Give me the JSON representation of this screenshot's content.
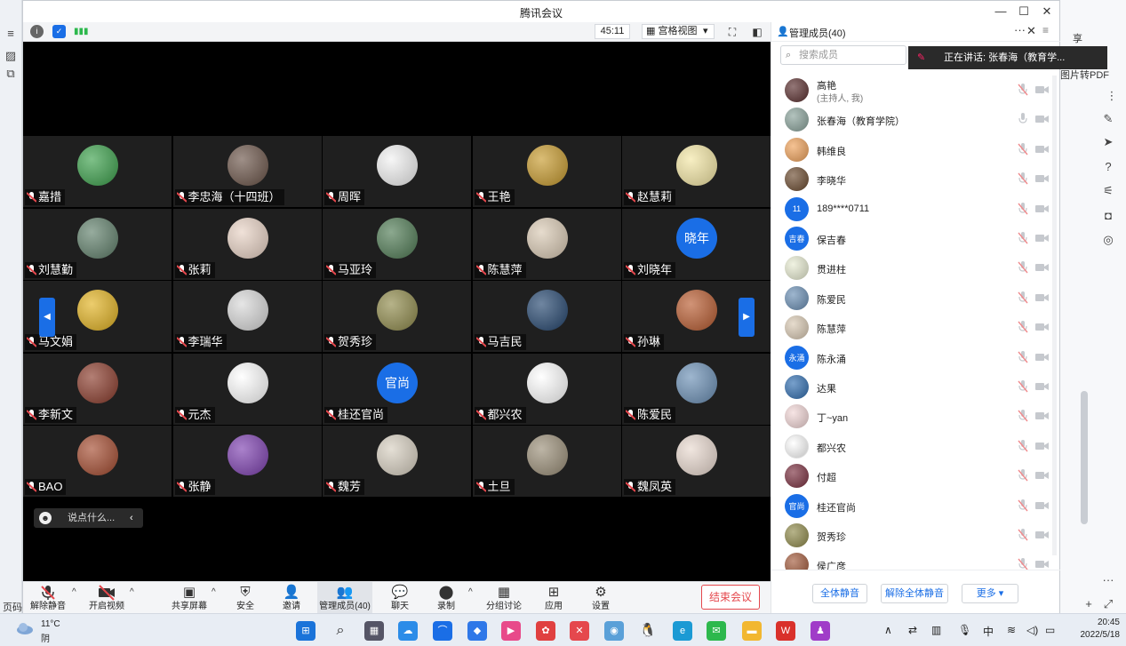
{
  "window": {
    "title": "腾讯会议",
    "controls": [
      "—",
      "☐",
      "✕"
    ]
  },
  "meeting_bar": {
    "timer": "45:11",
    "view_mode": "宫格视图",
    "view_caret": "▾"
  },
  "participants": [
    {
      "name": "嘉措",
      "avatar": {
        "type": "img",
        "bg": "#3aa04a"
      }
    },
    {
      "name": "李忠海（十四班）",
      "avatar": {
        "type": "img",
        "bg": "#6b5448"
      }
    },
    {
      "name": "周晖",
      "avatar": {
        "type": "img",
        "bg": "#f2f2f2"
      }
    },
    {
      "name": "王艳",
      "avatar": {
        "type": "img",
        "bg": "#c79a2c"
      }
    },
    {
      "name": "赵慧莉",
      "avatar": {
        "type": "img",
        "bg": "#f4e7a4"
      }
    },
    {
      "name": "刘慧勤",
      "avatar": {
        "type": "img",
        "bg": "#5f7f6a"
      }
    },
    {
      "name": "张莉",
      "avatar": {
        "type": "img",
        "bg": "#e8d2c4"
      }
    },
    {
      "name": "马亚玲",
      "avatar": {
        "type": "img",
        "bg": "#4e7a53"
      }
    },
    {
      "name": "陈慧萍",
      "avatar": {
        "type": "img",
        "bg": "#d9c9b3"
      }
    },
    {
      "name": "刘晓年",
      "avatar": {
        "type": "text",
        "text": "晓年",
        "bg": "#1a6ee6"
      }
    },
    {
      "name": "马文娟",
      "avatar": {
        "type": "img",
        "bg": "#e2b21f"
      }
    },
    {
      "name": "李瑞华",
      "avatar": {
        "type": "img",
        "bg": "#d8d8d8"
      }
    },
    {
      "name": "贺秀珍",
      "avatar": {
        "type": "img",
        "bg": "#8f8a4a"
      }
    },
    {
      "name": "马吉民",
      "avatar": {
        "type": "img",
        "bg": "#23456e"
      }
    },
    {
      "name": "孙琳",
      "avatar": {
        "type": "img",
        "bg": "#b85a2e"
      }
    },
    {
      "name": "李新文",
      "avatar": {
        "type": "img",
        "bg": "#8a3a2a"
      }
    },
    {
      "name": "元杰",
      "avatar": {
        "type": "img",
        "bg": "#ffffff"
      }
    },
    {
      "name": "桂还官尚",
      "avatar": {
        "type": "text",
        "text": "官尚",
        "bg": "#1a6ee6"
      }
    },
    {
      "name": "都兴农",
      "avatar": {
        "type": "img",
        "bg": "#ffffff"
      }
    },
    {
      "name": "陈爱民",
      "avatar": {
        "type": "img",
        "bg": "#6a8fb5"
      }
    },
    {
      "name": "BAO",
      "avatar": {
        "type": "img",
        "bg": "#a44a2e"
      }
    },
    {
      "name": "张静",
      "avatar": {
        "type": "img",
        "bg": "#7d3fb0"
      }
    },
    {
      "name": "魏芳",
      "avatar": {
        "type": "img",
        "bg": "#d7cfc0"
      }
    },
    {
      "name": "土旦",
      "avatar": {
        "type": "img",
        "bg": "#9a8e77"
      }
    },
    {
      "name": "魏凤英",
      "avatar": {
        "type": "img",
        "bg": "#e9d9cf"
      }
    }
  ],
  "pager": {
    "prev": "◀",
    "next": "▶"
  },
  "chat": {
    "placeholder": "说点什么...",
    "collapse": "‹",
    "emoji": "☻"
  },
  "toolbar": {
    "unmute": "解除静音",
    "start_video": "开启视频",
    "share_screen": "共享屏幕",
    "security": "安全",
    "invite": "邀请",
    "manage_members": "管理成员(40)",
    "chat": "聊天",
    "record": "录制",
    "breakout": "分组讨论",
    "apps": "应用",
    "settings": "设置",
    "end_meeting": "结束会议",
    "caret": "^"
  },
  "panel": {
    "title": "管理成员(40)",
    "more": "···",
    "close": "✕",
    "menu": "≡",
    "search_placeholder": "搜索成员",
    "speaking": "正在讲话: 张春海（教育学...",
    "mute_all": "全体静音",
    "unmute_all": "解除全体静音",
    "more_btn": "更多 ▾"
  },
  "members": [
    {
      "name": "高艳",
      "sub": "(主持人, 我)",
      "avatar": {
        "type": "img",
        "bg": "#5a2e2e"
      },
      "mic_muted": true
    },
    {
      "name": "张春海（教育学院）",
      "sub": "",
      "avatar": {
        "type": "img",
        "bg": "#8aa39b"
      },
      "mic_muted": false
    },
    {
      "name": "韩维良",
      "sub": "",
      "avatar": {
        "type": "img",
        "bg": "#f0a25a"
      },
      "mic_muted": true
    },
    {
      "name": "李晓华",
      "sub": "",
      "avatar": {
        "type": "img",
        "bg": "#6b4a2e"
      },
      "mic_muted": true
    },
    {
      "name": "189****0711",
      "sub": "",
      "avatar": {
        "type": "text",
        "text": "11",
        "bg": "#1a6ee6"
      },
      "mic_muted": true
    },
    {
      "name": "保吉春",
      "sub": "",
      "avatar": {
        "type": "text",
        "text": "吉春",
        "bg": "#1a6ee6"
      },
      "mic_muted": true
    },
    {
      "name": "贯进柱",
      "sub": "",
      "avatar": {
        "type": "img",
        "bg": "#e8ecd2"
      },
      "mic_muted": true
    },
    {
      "name": "陈爱民",
      "sub": "",
      "avatar": {
        "type": "img",
        "bg": "#6a8fb5"
      },
      "mic_muted": true
    },
    {
      "name": "陈慧萍",
      "sub": "",
      "avatar": {
        "type": "img",
        "bg": "#d9c9b3"
      },
      "mic_muted": true
    },
    {
      "name": "陈永涌",
      "sub": "",
      "avatar": {
        "type": "text",
        "text": "永涌",
        "bg": "#1a6ee6"
      },
      "mic_muted": true
    },
    {
      "name": "达果",
      "sub": "",
      "avatar": {
        "type": "img",
        "bg": "#2f6db0"
      },
      "mic_muted": true
    },
    {
      "name": "丁~yan",
      "sub": "",
      "avatar": {
        "type": "img",
        "bg": "#f2d6d6"
      },
      "mic_muted": true
    },
    {
      "name": "都兴农",
      "sub": "",
      "avatar": {
        "type": "img",
        "bg": "#ffffff"
      },
      "mic_muted": true
    },
    {
      "name": "付超",
      "sub": "",
      "avatar": {
        "type": "img",
        "bg": "#7a2e3e"
      },
      "mic_muted": true
    },
    {
      "name": "桂还官尚",
      "sub": "",
      "avatar": {
        "type": "text",
        "text": "官尚",
        "bg": "#1a6ee6"
      },
      "mic_muted": true
    },
    {
      "name": "贺秀珍",
      "sub": "",
      "avatar": {
        "type": "img",
        "bg": "#8f8a4a"
      },
      "mic_muted": true
    },
    {
      "name": "侯广彦",
      "sub": "",
      "avatar": {
        "type": "img",
        "bg": "#a2593a"
      },
      "mic_muted": true
    }
  ],
  "background_app": {
    "right_text_1": "享",
    "right_text_2": "图片转PDF",
    "left_text": "页码"
  },
  "taskbar": {
    "weather_temp": "11°C",
    "weather_desc": "阴",
    "ime": "中",
    "time": "20:45",
    "date": "2022/5/18"
  },
  "colors": {
    "accent": "#1a6ee6",
    "danger": "#e5484d",
    "tile_bg": "#1f1f1f"
  }
}
